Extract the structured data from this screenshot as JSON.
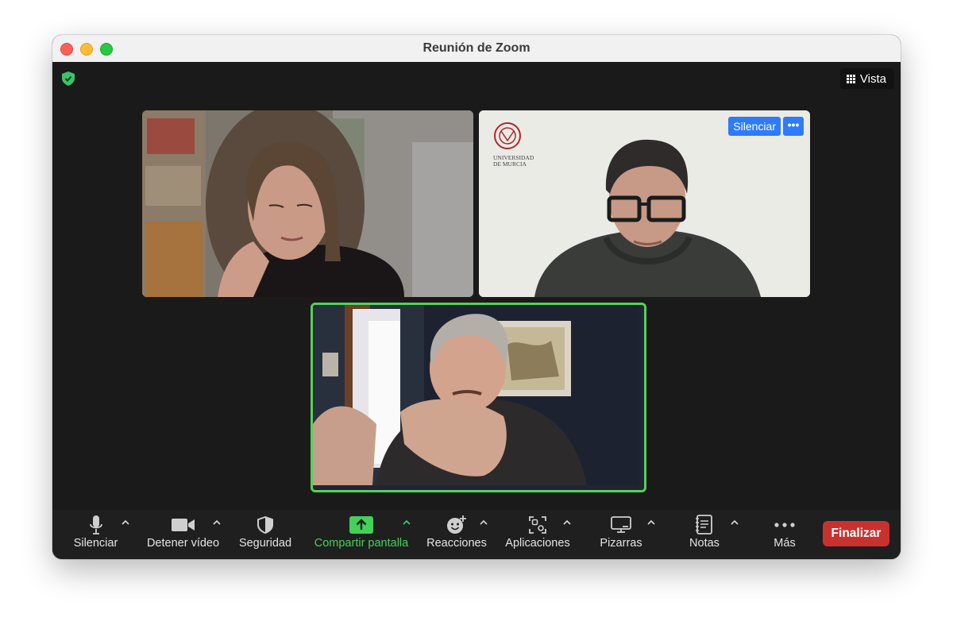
{
  "window": {
    "title": "Reunión de Zoom"
  },
  "header": {
    "view_label": "Vista"
  },
  "participants": [
    {
      "tile": "top-left"
    },
    {
      "tile": "top-right",
      "logo_text": [
        "UNIVERSIDAD",
        "DE MURCIA"
      ],
      "mute_label": "Silenciar",
      "more_label": "•••"
    },
    {
      "tile": "bottom-center",
      "active_speaker": true
    }
  ],
  "toolbar": {
    "items": [
      {
        "label": "Silenciar",
        "icon": "microphone-icon"
      },
      {
        "label": "Detener vídeo",
        "icon": "video-camera-icon"
      },
      {
        "label": "Seguridad",
        "icon": "shield-icon"
      },
      {
        "label": "Compartir pantalla",
        "icon": "share-screen-icon"
      },
      {
        "label": "Reacciones",
        "icon": "emoji-plus-icon"
      },
      {
        "label": "Aplicaciones",
        "icon": "apps-icon"
      },
      {
        "label": "Pizarras",
        "icon": "whiteboard-icon"
      },
      {
        "label": "Notas",
        "icon": "notes-icon"
      },
      {
        "label": "Más",
        "icon": "more-dots-icon"
      }
    ],
    "end_label": "Finalizar"
  },
  "colors": {
    "active_speaker_border": "#56cf5a",
    "share_green": "#43d15a",
    "end_red": "#c9312f",
    "participant_button_blue": "#2d7bff"
  }
}
